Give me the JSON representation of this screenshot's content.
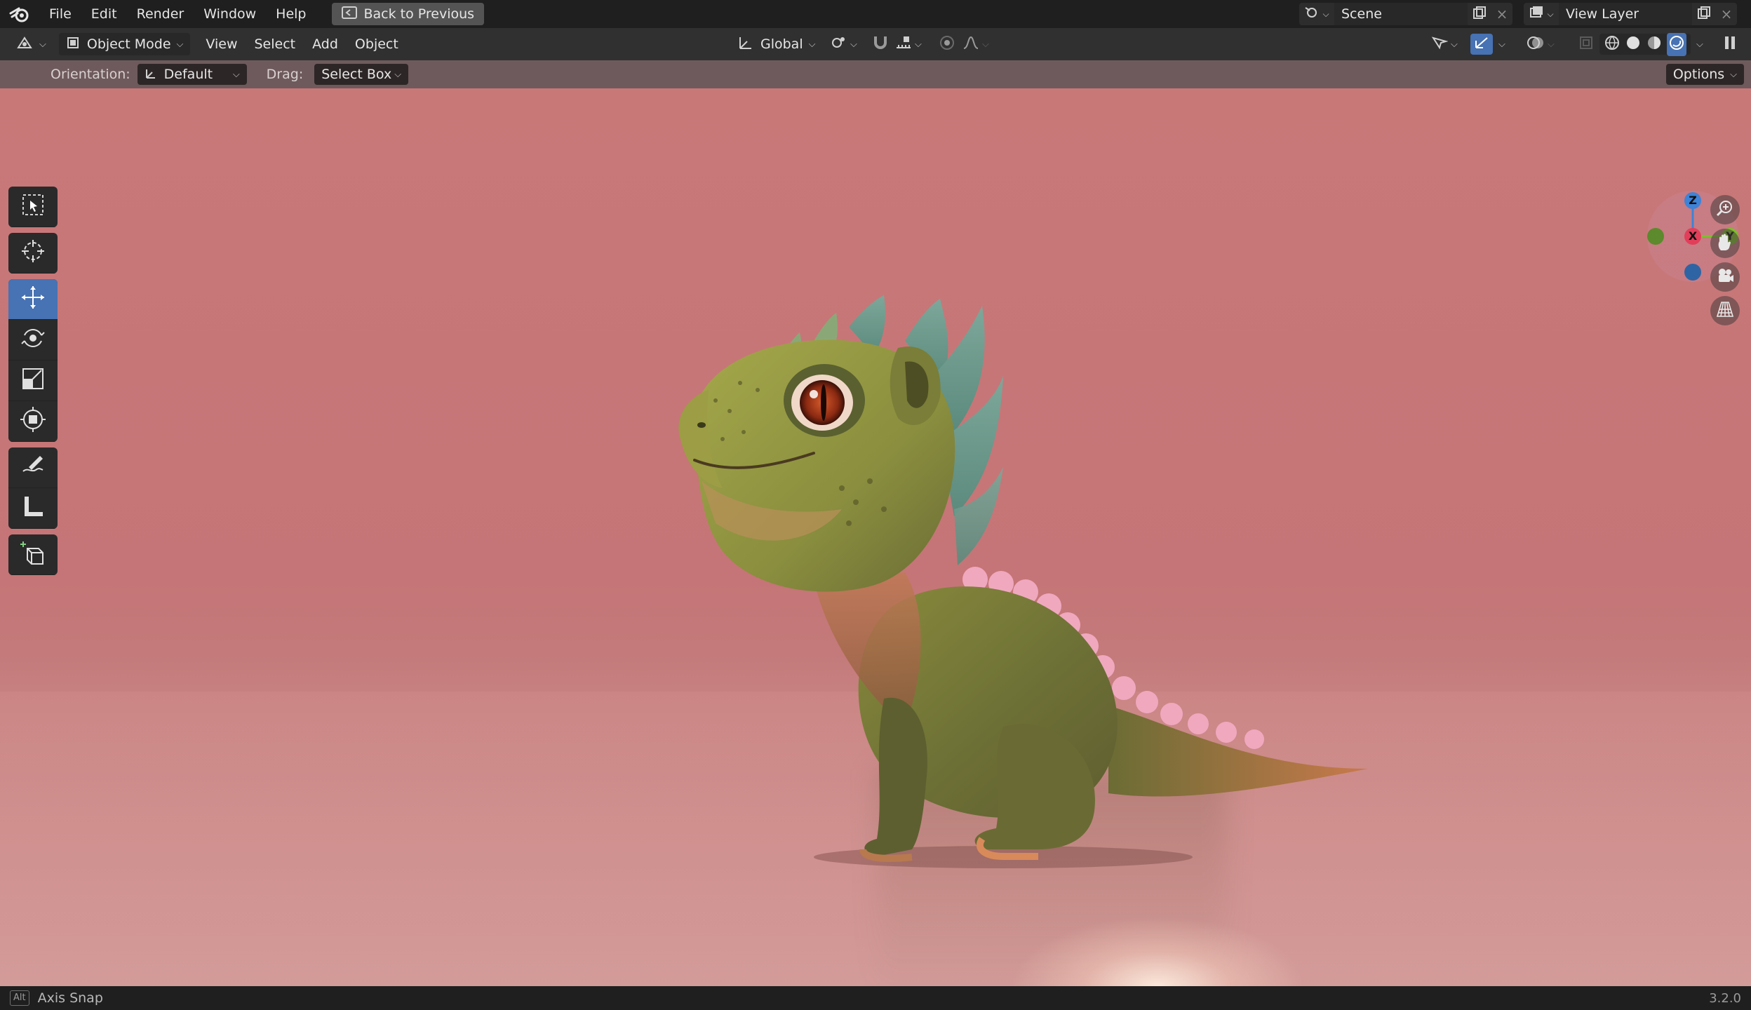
{
  "topbar": {
    "menus": [
      "File",
      "Edit",
      "Render",
      "Window",
      "Help"
    ],
    "back_button": "Back to Previous",
    "scene_name": "Scene",
    "view_layer_name": "View Layer"
  },
  "header": {
    "mode": "Object Mode",
    "menus": [
      "View",
      "Select",
      "Add",
      "Object"
    ],
    "transform_orientation": "Global"
  },
  "tool_settings": {
    "orientation_label": "Orientation:",
    "orientation_value": "Default",
    "drag_label": "Drag:",
    "drag_value": "Select Box",
    "options_label": "Options"
  },
  "gizmo": {
    "z_label": "Z",
    "x_label": "X",
    "y_label": "Y",
    "colors": {
      "x": "#e23e5a",
      "y": "#7cbf2a",
      "z": "#3d83d8",
      "neg_y": "#5c8a2c",
      "neg_z": "#2f64a4"
    }
  },
  "toolbar": {
    "tools": [
      "select-box",
      "cursor",
      "move",
      "rotate",
      "scale",
      "transform",
      "annotate",
      "measure",
      "add-cube"
    ],
    "active_tool": "move"
  },
  "status": {
    "key": "Alt",
    "hint": "Axis Snap",
    "version": "3.2.0"
  },
  "theme": {
    "accent": "#4772b3",
    "viewport_bg": "#c77777"
  }
}
